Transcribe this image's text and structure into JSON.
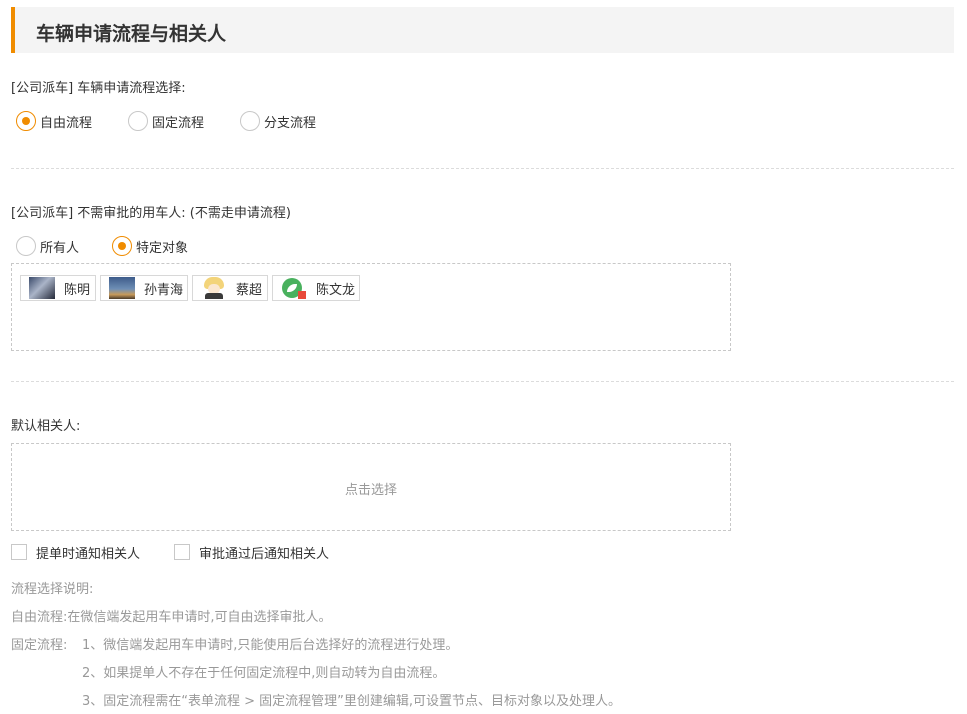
{
  "header": {
    "title": "车辆申请流程与相关人"
  },
  "flow_section": {
    "label": "[公司派车] 车辆申请流程选择:",
    "options": [
      {
        "label": "自由流程",
        "checked": true
      },
      {
        "label": "固定流程",
        "checked": false
      },
      {
        "label": "分支流程",
        "checked": false
      }
    ]
  },
  "exempt_section": {
    "label": "[公司派车] 不需审批的用车人: (不需走申请流程)",
    "options": [
      {
        "label": "所有人",
        "checked": false
      },
      {
        "label": "特定对象",
        "checked": true
      }
    ],
    "users": [
      {
        "name": "陈明",
        "avatar": "photo-avatar"
      },
      {
        "name": "孙青海",
        "avatar": "landscape-avatar"
      },
      {
        "name": "蔡超",
        "avatar": "cartoon-avatar"
      },
      {
        "name": "陈文龙",
        "avatar": "logo-avatar"
      }
    ]
  },
  "related_section": {
    "label": "默认相关人:",
    "placeholder": "点击选择",
    "checkboxes": [
      {
        "label": "提单时通知相关人",
        "checked": false
      },
      {
        "label": "审批通过后通知相关人",
        "checked": false
      }
    ]
  },
  "notes": {
    "heading": "流程选择说明:",
    "free_flow": "自由流程:在微信端发起用车申请时,可自由选择审批人。",
    "fixed_flow_prefix": "固定流程:",
    "fixed_flow_items": [
      "1、微信端发起用车申请时,只能使用后台选择好的流程进行处理。",
      "2、如果提单人不存在于任何固定流程中,则自动转为自由流程。",
      "3、固定流程需在“表单流程 > 固定流程管理”里创建编辑,可设置节点、目标对象以及处理人。"
    ]
  },
  "colors": {
    "accent": "#f08c00",
    "muted_text": "#999999",
    "border": "#c8c8c8"
  }
}
